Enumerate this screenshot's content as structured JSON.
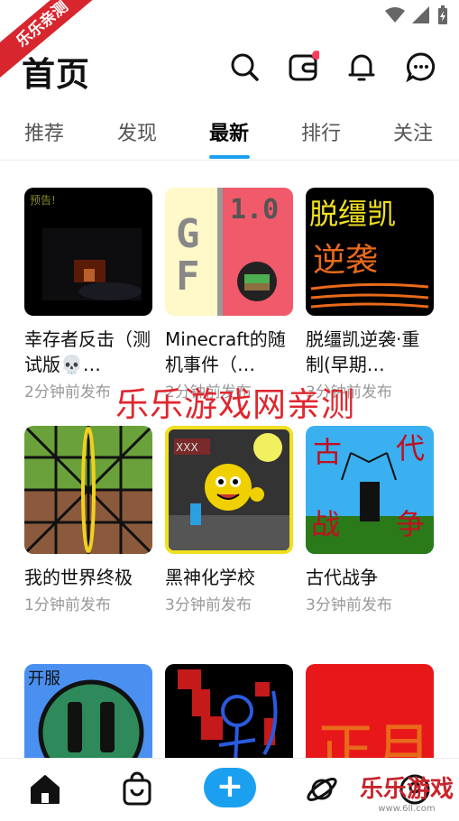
{
  "watermark": {
    "ribbon": "乐乐亲测",
    "center": "乐乐游戏网亲测",
    "corner_title": "乐乐游戏",
    "corner_url": "www.6ll.com"
  },
  "header": {
    "title": "首页"
  },
  "tabs": [
    {
      "label": "推荐"
    },
    {
      "label": "发现"
    },
    {
      "label": "最新"
    },
    {
      "label": "排行"
    },
    {
      "label": "关注"
    }
  ],
  "cards": [
    {
      "title": "幸存者反击（测试版💀…",
      "time": "2分钟前发布"
    },
    {
      "title": "Minecraft的随机事件（…",
      "time": "2分钟前发布"
    },
    {
      "title": "脱缰凯逆袭·重制(早期…",
      "time": "3分钟前发布"
    },
    {
      "title": "我的世界终极",
      "time": "1分钟前发布"
    },
    {
      "title": "黑神化学校",
      "time": "3分钟前发布"
    },
    {
      "title": "古代战争",
      "time": "3分钟前发布"
    }
  ],
  "thumb_text": {
    "t1": "预告!",
    "t2a": "G",
    "t2b": "F",
    "t2c": "1.0",
    "t3a": "脱缰凯",
    "t3b": "逆袭",
    "t5": "XXX",
    "t6a": "古",
    "t6b": "代",
    "t6c": "战",
    "t6d": "争",
    "t7": "开服",
    "t9": "正月"
  },
  "colors": {
    "accent": "#1ba0f0",
    "notify_dot": "#ff3b5c"
  },
  "icons": [
    "search-icon",
    "wallet-icon",
    "bell-icon",
    "chat-icon",
    "home-icon",
    "bag-icon",
    "plus-icon",
    "planet-icon",
    "profile-icon"
  ]
}
